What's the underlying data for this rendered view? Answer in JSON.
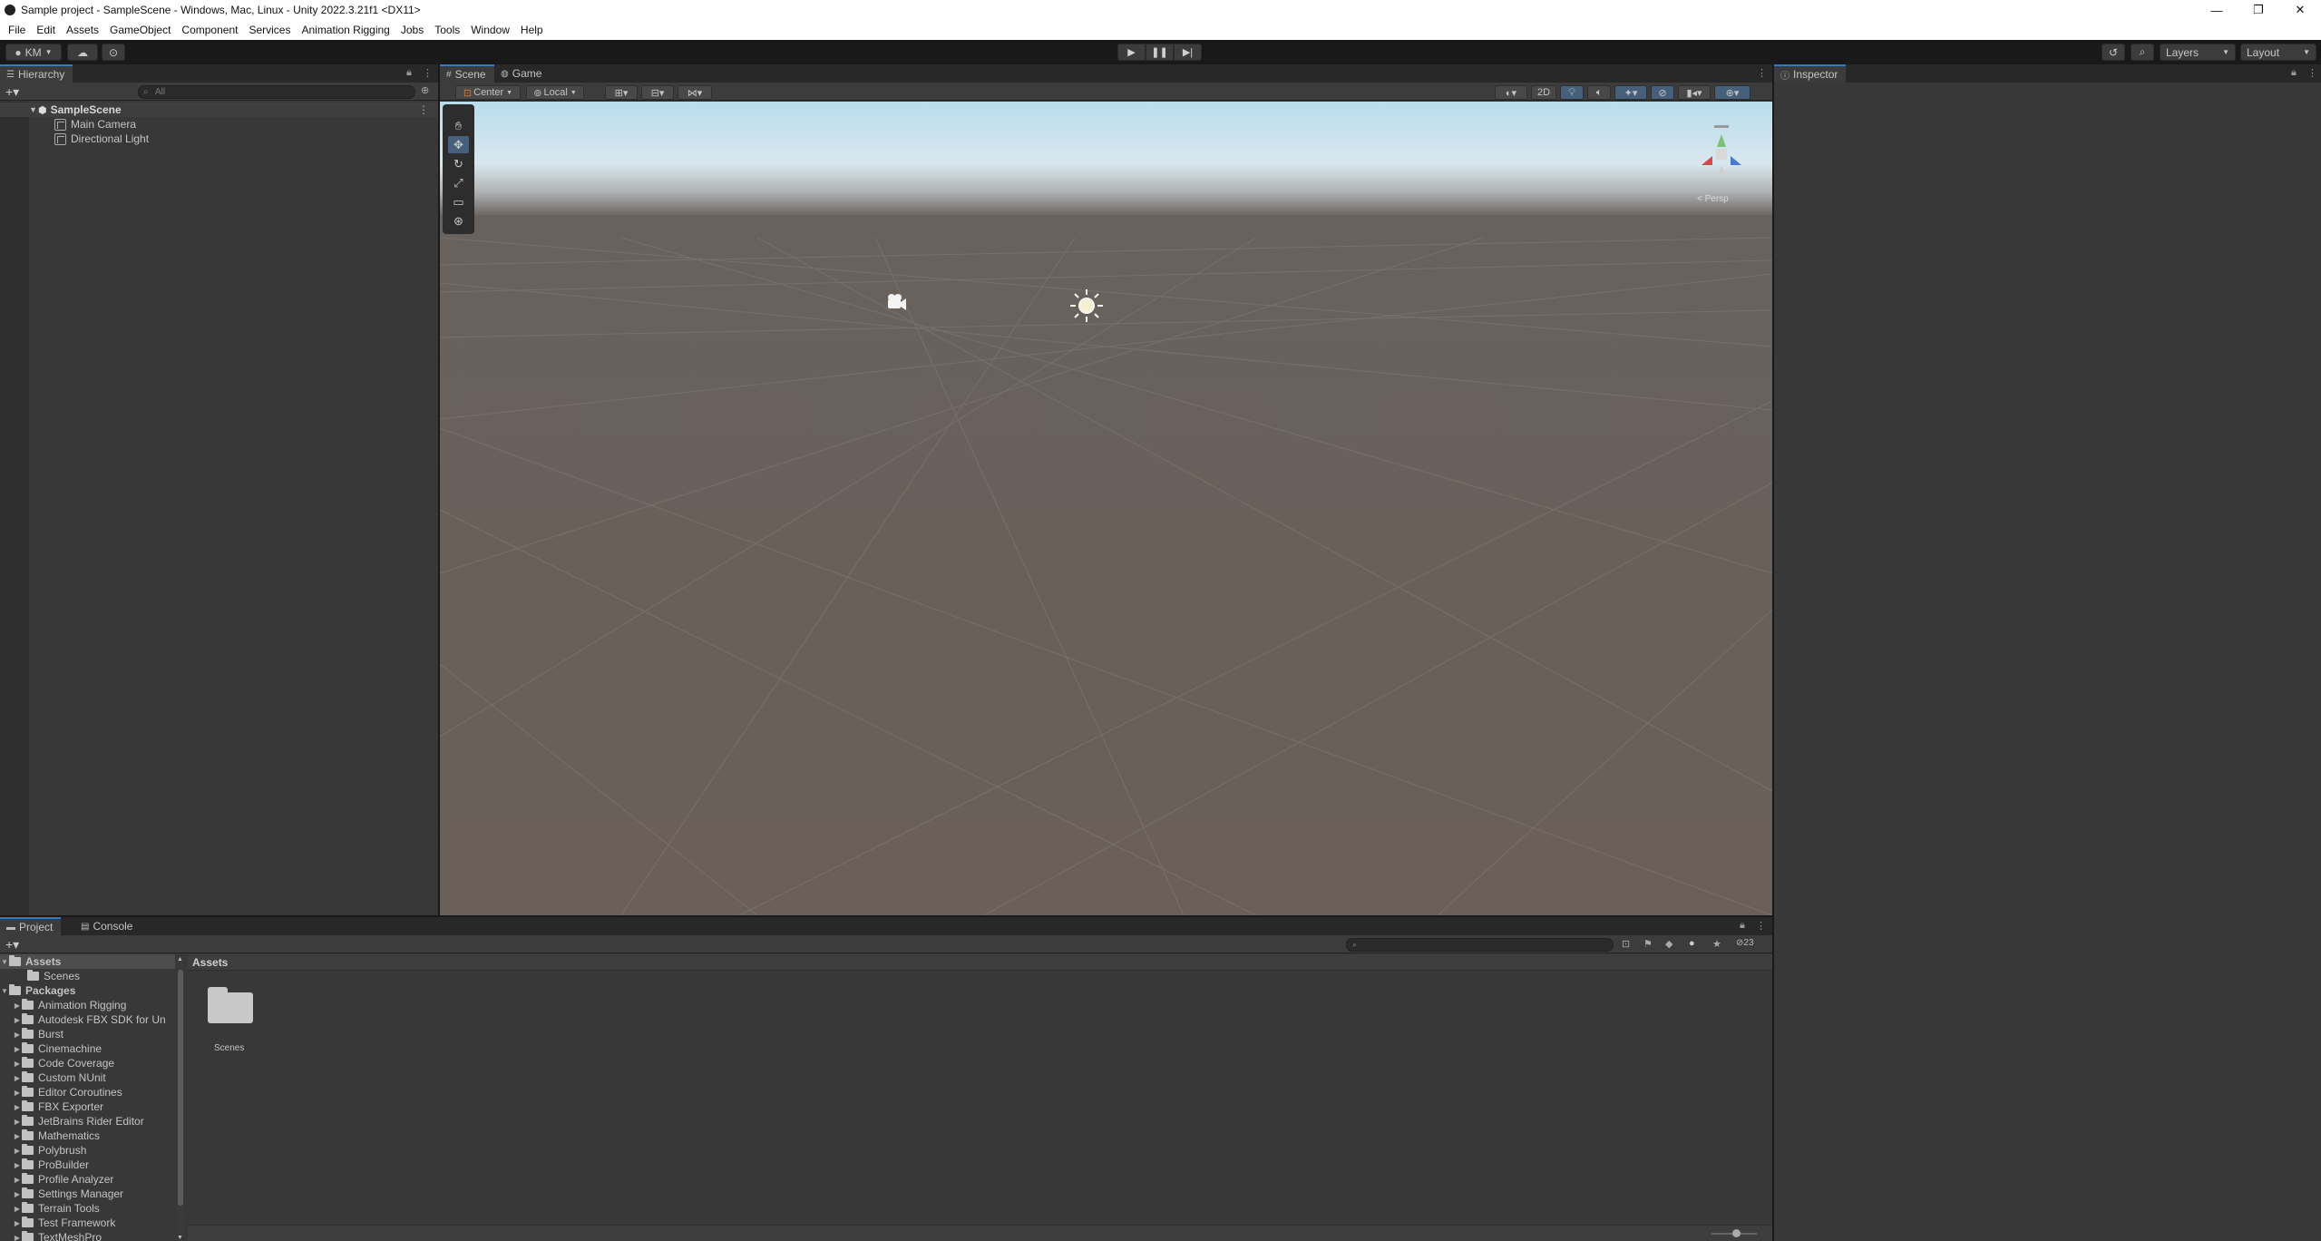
{
  "window": {
    "title": "Sample project - SampleScene - Windows, Mac, Linux - Unity 2022.3.21f1 <DX11>",
    "controls": [
      "—",
      "❐",
      "✕"
    ]
  },
  "menu": [
    "File",
    "Edit",
    "Assets",
    "GameObject",
    "Component",
    "Services",
    "Animation Rigging",
    "Jobs",
    "Tools",
    "Window",
    "Help"
  ],
  "toolbar": {
    "account": "KM",
    "layers": "Layers",
    "layout": "Layout"
  },
  "hierarchy": {
    "tab": "Hierarchy",
    "search_placeholder": "All",
    "scene": "SampleScene",
    "objects": [
      "Main Camera",
      "Directional Light"
    ]
  },
  "scene_view": {
    "tabs": [
      "Scene",
      "Game"
    ],
    "pivot": "Center",
    "space": "Local",
    "mode_2d": "2D",
    "persp_label": "< Persp"
  },
  "inspector": {
    "tab": "Inspector"
  },
  "project": {
    "tabs": [
      "Project",
      "Console"
    ],
    "hidden_count": "23",
    "breadcrumb": "Assets",
    "tree": {
      "assets": "Assets",
      "assets_children": [
        "Scenes"
      ],
      "packages": "Packages",
      "packages_children": [
        "Animation Rigging",
        "Autodesk FBX SDK for Un",
        "Burst",
        "Cinemachine",
        "Code Coverage",
        "Custom NUnit",
        "Editor Coroutines",
        "FBX Exporter",
        "JetBrains Rider Editor",
        "Mathematics",
        "Polybrush",
        "ProBuilder",
        "Profile Analyzer",
        "Settings Manager",
        "Terrain Tools",
        "Test Framework",
        "TextMeshPro"
      ]
    },
    "grid_items": [
      "Scenes"
    ]
  },
  "colors": {
    "accent": "#3a79bb",
    "sky_top": "#b9dcec",
    "ground": "#6b625b"
  }
}
